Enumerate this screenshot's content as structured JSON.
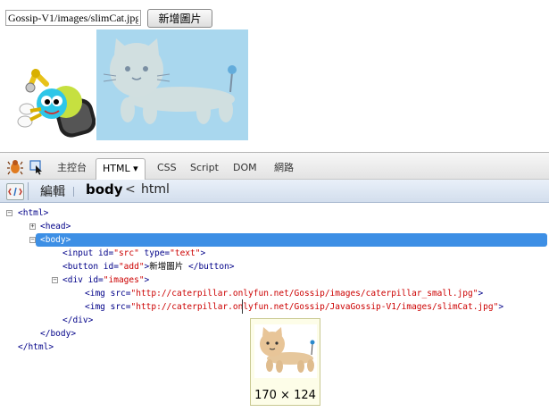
{
  "page": {
    "src_input_value": "Gossip-V1/images/slimCat.jpg",
    "add_button_label": "新增圖片"
  },
  "firebug": {
    "tabs": [
      "主控台",
      "HTML ▾",
      "CSS",
      "Script",
      "DOM",
      "網路"
    ],
    "toolbar": {
      "edit_label": "編輯",
      "crumb_body": "body",
      "crumb_arrow": "<",
      "crumb_html": "html"
    },
    "tree": {
      "html_open": "<html>",
      "head": "<head>",
      "body_open": "<body>",
      "input_line": {
        "pre": "<input ",
        "a1": "id=",
        "v1": "\"src\"",
        "a2": " type=",
        "v2": "\"text\"",
        "post": ">"
      },
      "button_line": {
        "pre": "<button ",
        "a1": "id=",
        "v1": "\"add\"",
        "mid": ">",
        "text": "新增圖片",
        "post": " </button>"
      },
      "div_line": {
        "pre": "<div ",
        "a1": "id=",
        "v1": "\"images\"",
        "post": ">"
      },
      "img1_line": {
        "pre": "<img ",
        "a1": "src=",
        "v1": "\"http://caterpillar.onlyfun.net/Gossip/images/caterpillar_small.jpg\"",
        "post": ">"
      },
      "img2_line": {
        "pre": "<img ",
        "a1": "src=",
        "v1": "\"http://caterpillar.onlyfun.net/Gossip/JavaGossip-V1/images/slimCat.jpg\"",
        "post": ">"
      },
      "div_close": "</div>",
      "body_close": "</body>",
      "html_close": "</html>"
    },
    "tooltip_size": "170 × 124"
  },
  "colors": {
    "selection": "#3d8fe5",
    "attr_value": "#cc0000",
    "tag": "#000088"
  }
}
